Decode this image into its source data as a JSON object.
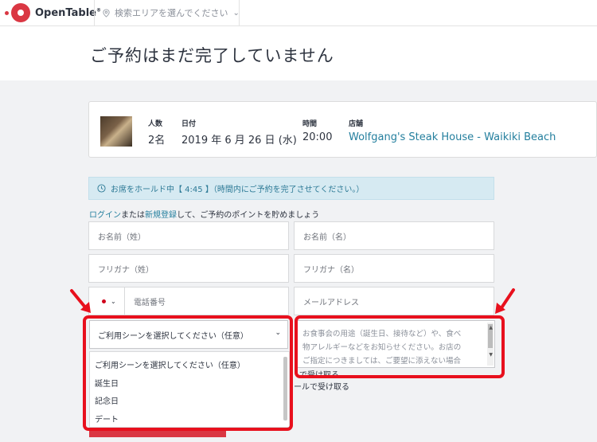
{
  "header": {
    "logo_text": "OpenTable",
    "logo_reg": "®",
    "location_placeholder": "検索エリアを選んでください",
    "location_chevron": "⌄"
  },
  "page": {
    "title": "ご予約はまだ完了していません"
  },
  "reservation": {
    "party_label": "人数",
    "party_value": "2名",
    "date_label": "日付",
    "date_value": "2019 年 6 月 26 日 (水)",
    "time_label": "時間",
    "time_value": "20:00",
    "restaurant_label": "店舗",
    "restaurant_value": "Wolfgang's Steak House - Waikiki Beach"
  },
  "hold_notice": {
    "text": "お席をホールド中【 4:45 】（時間内にご予約を完了させてください。）"
  },
  "login_line": {
    "login": "ログイン",
    "or": "または",
    "register": "新規登録",
    "rest": "して、ご予約のポイントを貯めましょう"
  },
  "form": {
    "last_name": "お名前（姓）",
    "first_name": "お名前（名）",
    "kana_last": "フリガナ（姓）",
    "kana_first": "フリガナ（名）",
    "phone": "電話番号",
    "email": "メールアドレス",
    "occasion_selected": "ご利用シーンを選択してください（任意）",
    "occasion_options": [
      "ご利用シーンを選択してください（任意）",
      "誕生日",
      "記念日",
      "デート"
    ],
    "request_placeholder_1": "お食事会の用途（誕生日、接待など）や、食べ",
    "request_placeholder_2": "物アレルギーなどをお知らせください。お店の",
    "request_placeholder_3": "ご指定につきましては、ご要望に添えない場合",
    "overflow_1": "で受け取る",
    "overflow_2": "ールで受け取る"
  },
  "colors": {
    "brand": "#da3743",
    "link": "#247f9e",
    "highlight": "#e8101d",
    "hold_bg": "#d6eaf2"
  }
}
